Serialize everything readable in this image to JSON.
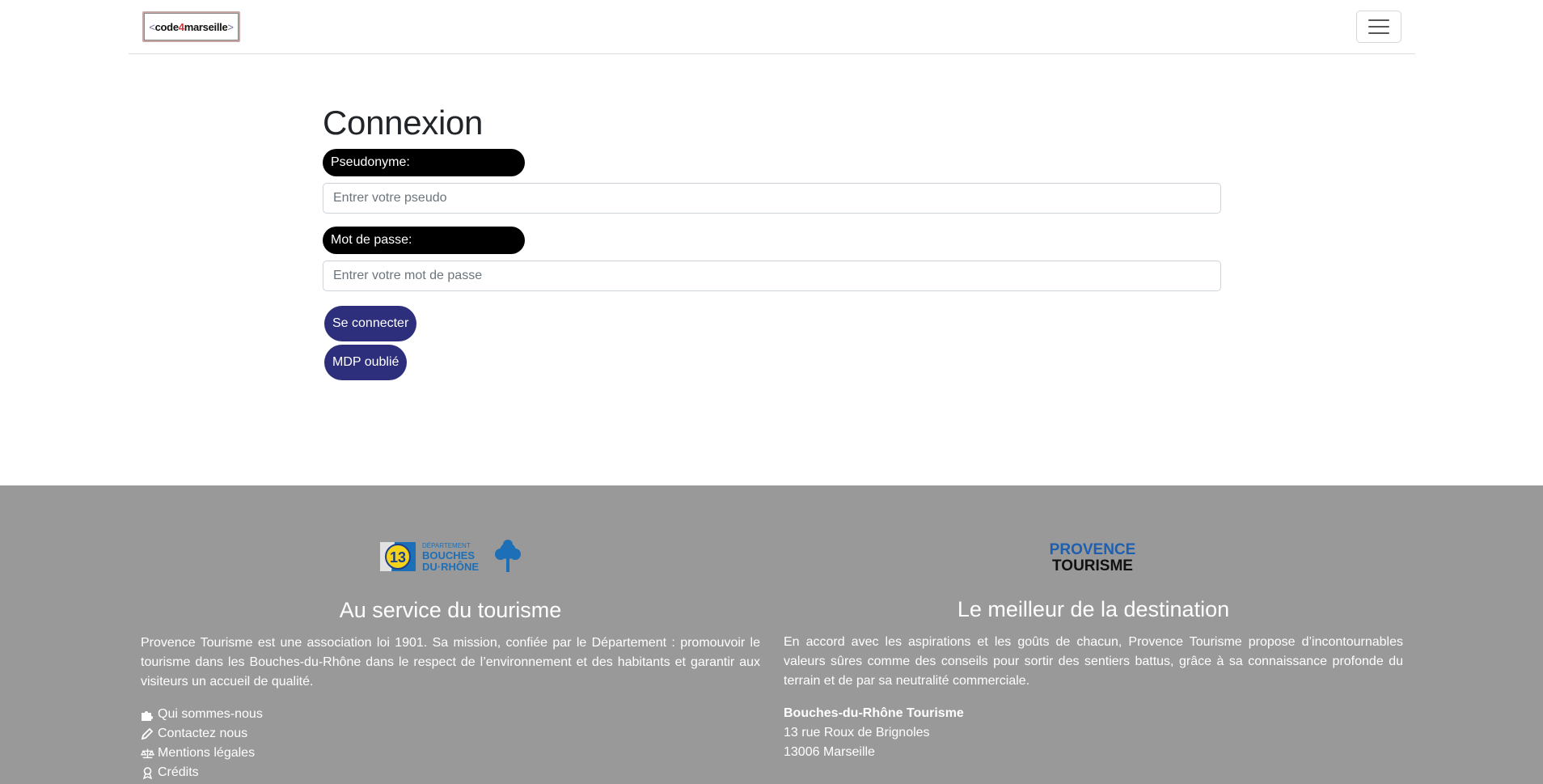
{
  "navbar": {
    "logo": {
      "open": "<",
      "part1": "code",
      "part2": "4",
      "part3": "marseille",
      "close": ">"
    }
  },
  "main": {
    "title": "Connexion",
    "pseudo_label": "Pseudonyme:",
    "pseudo_placeholder": "Entrer votre pseudo",
    "password_label": "Mot de passe:",
    "password_placeholder": "Entrer votre mot de passe",
    "login_button": "Se connecter",
    "forgot_button": "MDP oublié"
  },
  "footer": {
    "left": {
      "logo_text_top": "DÉPARTEMENT",
      "logo_text_mid": "BOUCHES",
      "logo_text_bot": "DU·RHÔNE",
      "title": "Au service du tourisme",
      "text": "Provence Tourisme est une association loi 1901. Sa mission, confiée par le Département : promouvoir le tourisme dans les Bouches-du-Rhône dans le respect de l’environnement et des habitants et garantir aux visiteurs un accueil de qualité.",
      "links": [
        "Qui sommes-nous",
        "Contactez nous",
        "Mentions légales",
        "Crédits"
      ]
    },
    "right": {
      "logo_line1": "PROVENCE",
      "logo_line2": "TOURISME",
      "title": "Le meilleur de la destination",
      "text": "En accord avec les aspirations et les goûts de chacun, Provence Tourisme propose d’incontournables valeurs sûres comme des conseils pour sortir des sentiers battus, grâce à sa connaissance profonde du terrain et de par sa neutralité commerciale.",
      "address_name": "Bouches-du-Rhône Tourisme",
      "address_line1": "13 rue Roux de Brignoles",
      "address_line2": "13006 Marseille"
    }
  },
  "colors": {
    "button": "#2e2f7c",
    "footer_bg": "#999999",
    "label_bg": "#000000"
  }
}
